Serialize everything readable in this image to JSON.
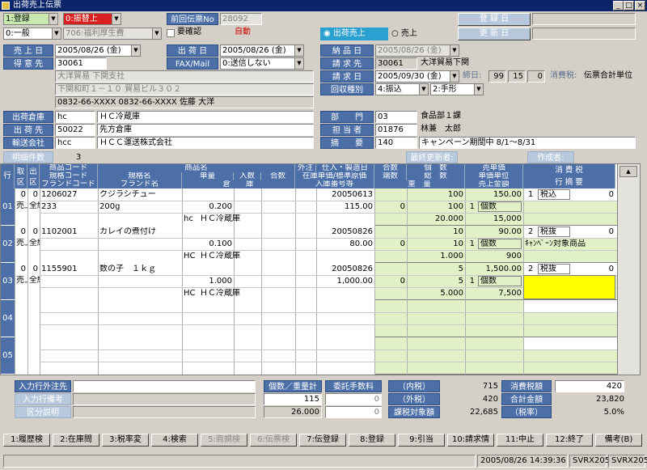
{
  "window": {
    "title": "出荷売上伝票"
  },
  "top": {
    "mode": "1:登録",
    "transfer": "0:振替上",
    "pricing": "0:一般",
    "account": "706:福利厚生費",
    "confirm_label": "要確認",
    "auto_label": "自動",
    "prev_slip_label": "前回伝票No",
    "prev_slip_value": "28092",
    "radio_ship": "出荷売上",
    "radio_sale": "売上",
    "reg_date_label": "登 録 日",
    "upd_date_label": "更 新 日"
  },
  "header": {
    "sales_date_label": "売 上 日",
    "sales_date": "2005/08/26 (金)",
    "ship_date_label": "出 荷 日",
    "ship_date": "2005/08/26 (金)",
    "customer_label": "得 意 先",
    "customer_code": "30061",
    "fax_label": "FAX/Mail",
    "fax_value": "0:送信しない",
    "customer_name": "大洋貿易 下関支社",
    "address": "下関和町１－１０ 貿易ビル３０２",
    "phone_line": "0832-66-XXXX 0832-66-XXXX 佐藤 大洋",
    "delivery_date_label": "納 品 日",
    "delivery_date": "2005/08/26 (金)",
    "bill_to_label": "請 求 先",
    "bill_to_code": "30061",
    "bill_to_name": "大洋貿易下関",
    "bill_date_label": "請 求 日",
    "bill_date": "2005/09/30 (金)",
    "close_label": "締日:",
    "close_day": "99",
    "close_a": "15",
    "close_b": "0",
    "tax_label": "消費税:",
    "tax_value": "伝票合計単位",
    "collect_label": "回収種別",
    "collect_a": "4:振込",
    "collect_b": "2:手形",
    "wh_label": "出荷倉庫",
    "wh_code": "hc",
    "wh_name": "ＨＣ冷蔵庫",
    "dest_label": "出 荷 先",
    "dest_code": "50022",
    "dest_name": "先方倉庫",
    "carrier_label": "輸送会社",
    "carrier_code": "hcc",
    "carrier_name": "ＨＣＣ運送株式会社",
    "dept_label": "部　　門",
    "dept_code": "03",
    "dept_name": "食品部１課",
    "staff_label": "担 当 者",
    "staff_code": "01876",
    "staff_name": "林兼　太郎",
    "memo_label": "摘　　要",
    "memo_code": "140",
    "memo_text": "キャンペーン期間中 8/1～8/31"
  },
  "detail_bar": {
    "count_label": "明細件数",
    "count_value": "3",
    "updated_by_label": "最終更新者:",
    "author_label": "作成者:"
  },
  "grid_headers": {
    "row": "行",
    "tori": "取区",
    "shutsu": "出区",
    "c1a": "商品コード",
    "c1b": "規格コード",
    "c1c": "ブランドコード",
    "c2a": "商品名",
    "c2b": "規格名",
    "c2c": "単量",
    "c2d": "入数",
    "c2e": "合数",
    "c2f": "ブランド名",
    "c2g": "倉　　庫",
    "c3a": "外注",
    "c3b": "仕入・製造日",
    "c3c": "在庫単価/標準原価",
    "c3d": "入庫番号等",
    "c4a": "合数",
    "c4b": "端数",
    "c5a": "個　数",
    "c5b": "総　数",
    "c5c": "重　量",
    "c6a": "売単価",
    "c6b": "単価単位",
    "c6c": "売上金額",
    "c7a": "消 費 税",
    "c7b": "行 摘 要"
  },
  "rows": [
    {
      "no": "01",
      "t": "0",
      "s": "0",
      "t2": "売上",
      "s2": "全納",
      "code": "1206027",
      "name": "クジラシチュー",
      "date": "20050613",
      "qty": "100",
      "price": "150.00",
      "tax_no": "1",
      "tax": "税込",
      "tax_amt": "0",
      "spec": "233",
      "spec_name": "200g",
      "unit": "0.200",
      "cost": "115.00",
      "frac": "0",
      "total": "100",
      "uu_no": "1",
      "uu": "個数",
      "memo": "",
      "wh_code": "hc",
      "wh": "ＨＣ冷蔵庫",
      "weight": "20.000",
      "amount": "15,000"
    },
    {
      "no": "02",
      "t": "0",
      "s": "0",
      "t2": "売上",
      "s2": "全納",
      "code": "1102001",
      "name": "カレイの煮付け",
      "date": "20050826",
      "qty": "10",
      "price": "90.00",
      "tax_no": "2",
      "tax": "税抜",
      "tax_amt": "0",
      "spec": "",
      "spec_name": "",
      "unit": "0.100",
      "cost": "80.00",
      "frac": "0",
      "total": "10",
      "uu_no": "1",
      "uu": "個数",
      "memo": "ｷｬﾝﾍﾟｰﾝ対象商品",
      "wh_code": "HC",
      "wh": "ＨＣ冷蔵庫",
      "weight": "1.000",
      "amount": "900"
    },
    {
      "no": "03",
      "t": "0",
      "s": "0",
      "t2": "売上",
      "s2": "全納",
      "code": "1155901",
      "name": "数の子　１ｋｇ",
      "date": "20050826",
      "qty": "5",
      "price": "1,500.00",
      "tax_no": "2",
      "tax": "税抜",
      "tax_amt": "0",
      "spec": "",
      "spec_name": "",
      "unit": "1.000",
      "cost": "1,000.00",
      "frac": "0",
      "total": "5",
      "uu_no": "1",
      "uu": "個数",
      "memo": "",
      "wh_code": "HC",
      "wh": "ＨＣ冷蔵庫",
      "weight": "5.000",
      "amount": "7,500"
    }
  ],
  "empty_rows": [
    "04",
    "05"
  ],
  "footer": {
    "outsrc_label": "入力行外注先",
    "remark_label": "入力行備考",
    "cat_label": "区分説明",
    "qty_weight_label": "個数／重量計",
    "fee_label": "委託手数料",
    "qty_total": "115",
    "fee1": "0",
    "weight_total": "26.000",
    "fee2": "0",
    "incl_tax_label": "（内税）",
    "incl_tax": "715",
    "excl_tax_label": "（外税）",
    "excl_tax": "420",
    "taxable_label": "課税対象額",
    "taxable": "22,685",
    "ctax_label": "消費税額",
    "ctax": "420",
    "total_label": "合計金額",
    "total": "23,820",
    "rate_label": "（税率）",
    "rate": "5.0%"
  },
  "fkeys": [
    "1:履歴検",
    "2:在庫問",
    "3:税率変",
    "4:検索",
    "5:商規検",
    "6:伝票検",
    "7:伝登録",
    "8:登録",
    "9:引当",
    "10:請求情",
    "11:中止",
    "12:終了",
    "備考(B)"
  ],
  "status": {
    "datetime": "2005/08/26 14:39:36",
    "user": "SVRX205",
    "host": "SVRX205"
  },
  "colors": {
    "label_blue": "#4c6fa8",
    "label_green": "#3a8a52",
    "title_bar": "#0a246a",
    "highlight_yellow": "#ffff00"
  }
}
